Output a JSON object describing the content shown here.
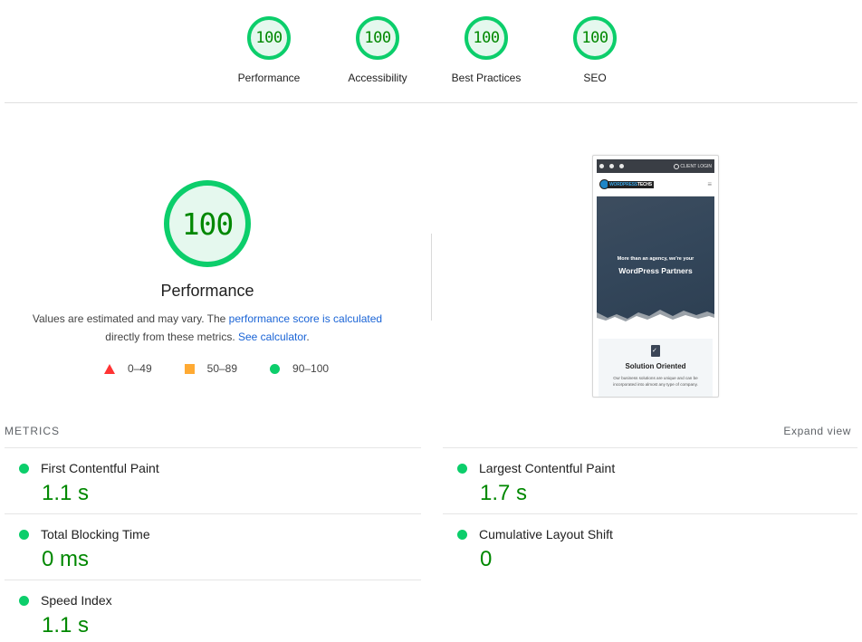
{
  "categories": [
    {
      "label": "Performance",
      "score": "100"
    },
    {
      "label": "Accessibility",
      "score": "100"
    },
    {
      "label": "Best Practices",
      "score": "100"
    },
    {
      "label": "SEO",
      "score": "100"
    }
  ],
  "performance": {
    "score": "100",
    "title": "Performance",
    "desc_prefix": "Values are estimated and may vary. The ",
    "desc_link1": "performance score is calculated",
    "desc_middle": " directly from these metrics. ",
    "desc_link2": "See calculator",
    "desc_suffix": ".",
    "legend": [
      {
        "shape": "triangle",
        "range": "0–49",
        "color": "#ff3333"
      },
      {
        "shape": "square",
        "range": "50–89",
        "color": "#ffaa33"
      },
      {
        "shape": "circle",
        "range": "90–100",
        "color": "#0cce6b"
      }
    ]
  },
  "screenshot": {
    "topbar_login": "CLIENT LOGIN",
    "logo_text_a": "WORDPRESS",
    "logo_text_b": "TECHS",
    "menu_icon": "≡",
    "hero_sub": "More than an agency, we're your",
    "hero_main": "WordPress Partners",
    "card_title": "Solution Oriented",
    "card_text": "Our business solutions are unique and can be incorporated into almost any type of company."
  },
  "metrics": {
    "header": "METRICS",
    "expand_label": "Expand view",
    "left": [
      {
        "name": "First Contentful Paint",
        "value": "1.1 s",
        "status": "pass"
      },
      {
        "name": "Total Blocking Time",
        "value": "0 ms",
        "status": "pass"
      },
      {
        "name": "Speed Index",
        "value": "1.1 s",
        "status": "pass"
      }
    ],
    "right": [
      {
        "name": "Largest Contentful Paint",
        "value": "1.7 s",
        "status": "pass"
      },
      {
        "name": "Cumulative Layout Shift",
        "value": "0",
        "status": "pass"
      }
    ]
  },
  "colors": {
    "pass": "#0cce6b",
    "pass_text": "#008800",
    "link": "#1a64d6"
  }
}
